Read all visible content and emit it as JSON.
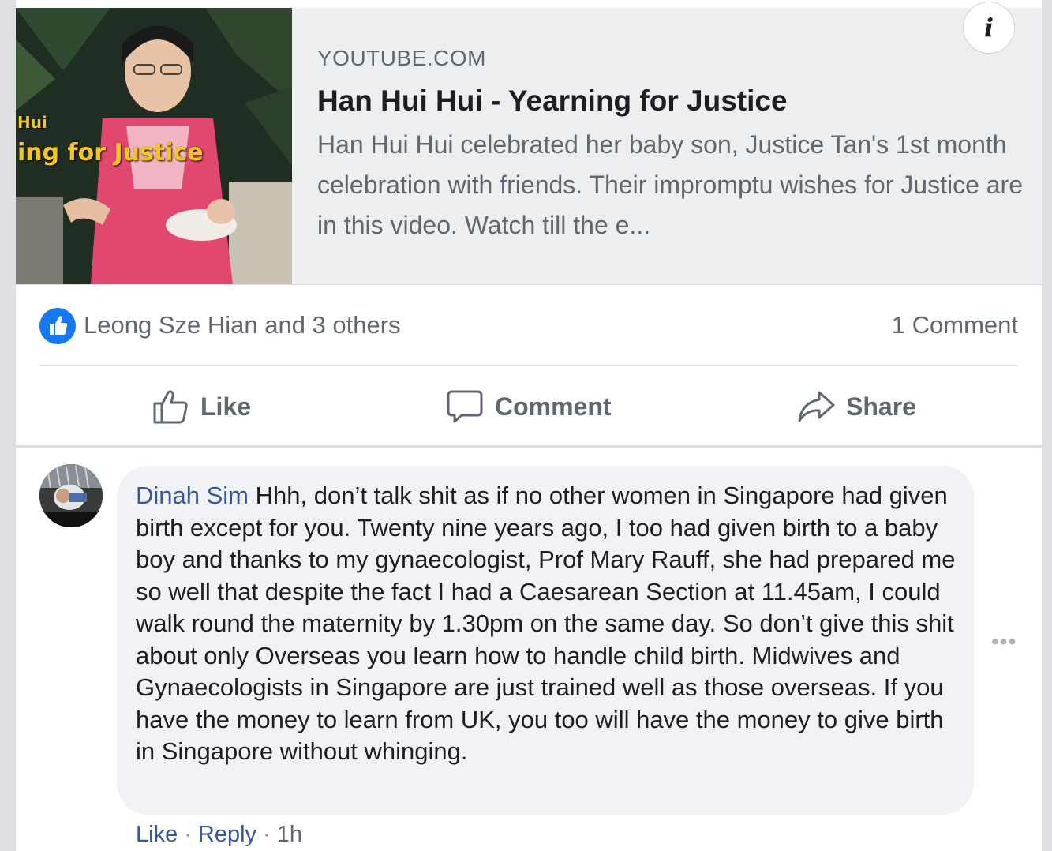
{
  "link_preview": {
    "thumbnail_overlay_line1": "Hui",
    "thumbnail_overlay_line2": "ing for Justice",
    "domain": "YOUTUBE.COM",
    "title": "Han Hui Hui - Yearning for Justice",
    "description": "Han Hui Hui celebrated her baby son, Justice Tan's 1st month celebration with friends. Their impromptu wishes for Justice are in this video. Watch till the e...",
    "info_icon": "info-icon",
    "info_glyph": "i"
  },
  "reactions": {
    "icon": "like-reaction-icon",
    "summary": "Leong Sze Hian and 3 others",
    "comment_count": "1 Comment"
  },
  "actions": {
    "like_label": "Like",
    "comment_label": "Comment",
    "share_label": "Share"
  },
  "comment": {
    "author": "Dinah Sim",
    "text": "Hhh, don’t talk shit as if no other women in Singapore had given birth except for you. Twenty nine years ago, I too had given birth to a baby boy and thanks to my gynaecologist, Prof Mary Rauff, she had prepared me so well that despite the fact I had a Caesarean Section at 11.45am, I could walk round the maternity by 1.30pm on the same day. So don’t give this shit about only Overseas you learn how to handle child birth. Midwives and Gynaecologists in Singapore are just trained well as those overseas. If you have the money to learn from UK, you too will have the money to give birth in Singapore without whinging.",
    "like_link": "Like",
    "reply_link": "Reply",
    "separator": "·",
    "time": "1h",
    "more_glyph": "•••"
  },
  "colors": {
    "facebook_blue": "#1877f2",
    "author_link": "#385898",
    "secondary_text": "#606770",
    "bubble_bg": "#f0f2f5"
  }
}
